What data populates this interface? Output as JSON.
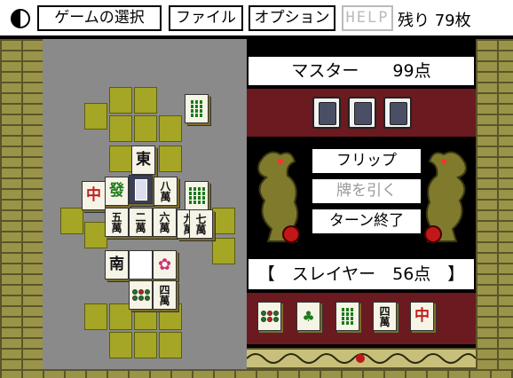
{
  "menu": {
    "game_select": "ゲームの選択",
    "file": "ファイル",
    "option": "オプション",
    "help": "HELP",
    "remaining": "残り 79枚"
  },
  "opponent": {
    "banner": "マスター　　99点",
    "name": "マスター",
    "score": "99点",
    "hidden_tiles": 3
  },
  "actions": {
    "flip": "フリップ",
    "draw": "牌を引く",
    "draw_enabled": false,
    "end_turn": "ターン終了"
  },
  "player": {
    "banner": "【　スレイヤー　56点　】",
    "name": "スレイヤー",
    "score": "56点",
    "hand": [
      {
        "name": "circle-8-tile",
        "chars": ""
      },
      {
        "name": "bamboo-1-bird-tile",
        "chars": ""
      },
      {
        "name": "bamboo-6-tile",
        "chars": ""
      },
      {
        "name": "character-4-tile",
        "chars": "四\n萬"
      },
      {
        "name": "red-dragon-tile",
        "chars": "中"
      }
    ]
  },
  "board": {
    "tiles": [
      {
        "name": "bamboo-tile-top",
        "chars": ""
      },
      {
        "name": "east-wind-tile",
        "chars": "東"
      },
      {
        "name": "red-dragon-tile",
        "chars": "中"
      },
      {
        "name": "green-hatsu-tile",
        "chars": "發"
      },
      {
        "name": "back-tile",
        "chars": ""
      },
      {
        "name": "character-8-tile",
        "chars": "八\n萬"
      },
      {
        "name": "bamboo-8-tile",
        "chars": ""
      },
      {
        "name": "character-5-tile",
        "chars": "五\n萬"
      },
      {
        "name": "character-2-tile",
        "chars": "二\n萬"
      },
      {
        "name": "character-6-tile",
        "chars": "六\n萬"
      },
      {
        "name": "character-9-tile",
        "chars": "九\n萬"
      },
      {
        "name": "character-7-tile",
        "chars": "七\n萬"
      },
      {
        "name": "south-wind-tile",
        "chars": "南"
      },
      {
        "name": "white-dragon-tile",
        "chars": ""
      },
      {
        "name": "flower-tile",
        "chars": ""
      },
      {
        "name": "circle-5-tile",
        "chars": ""
      },
      {
        "name": "character-4-tile",
        "chars": "四\n萬"
      }
    ]
  },
  "colors": {
    "board": "#8a8a8a",
    "slot": "#a5a526",
    "wall": "#9a9448",
    "maroon": "#6b1a20"
  }
}
